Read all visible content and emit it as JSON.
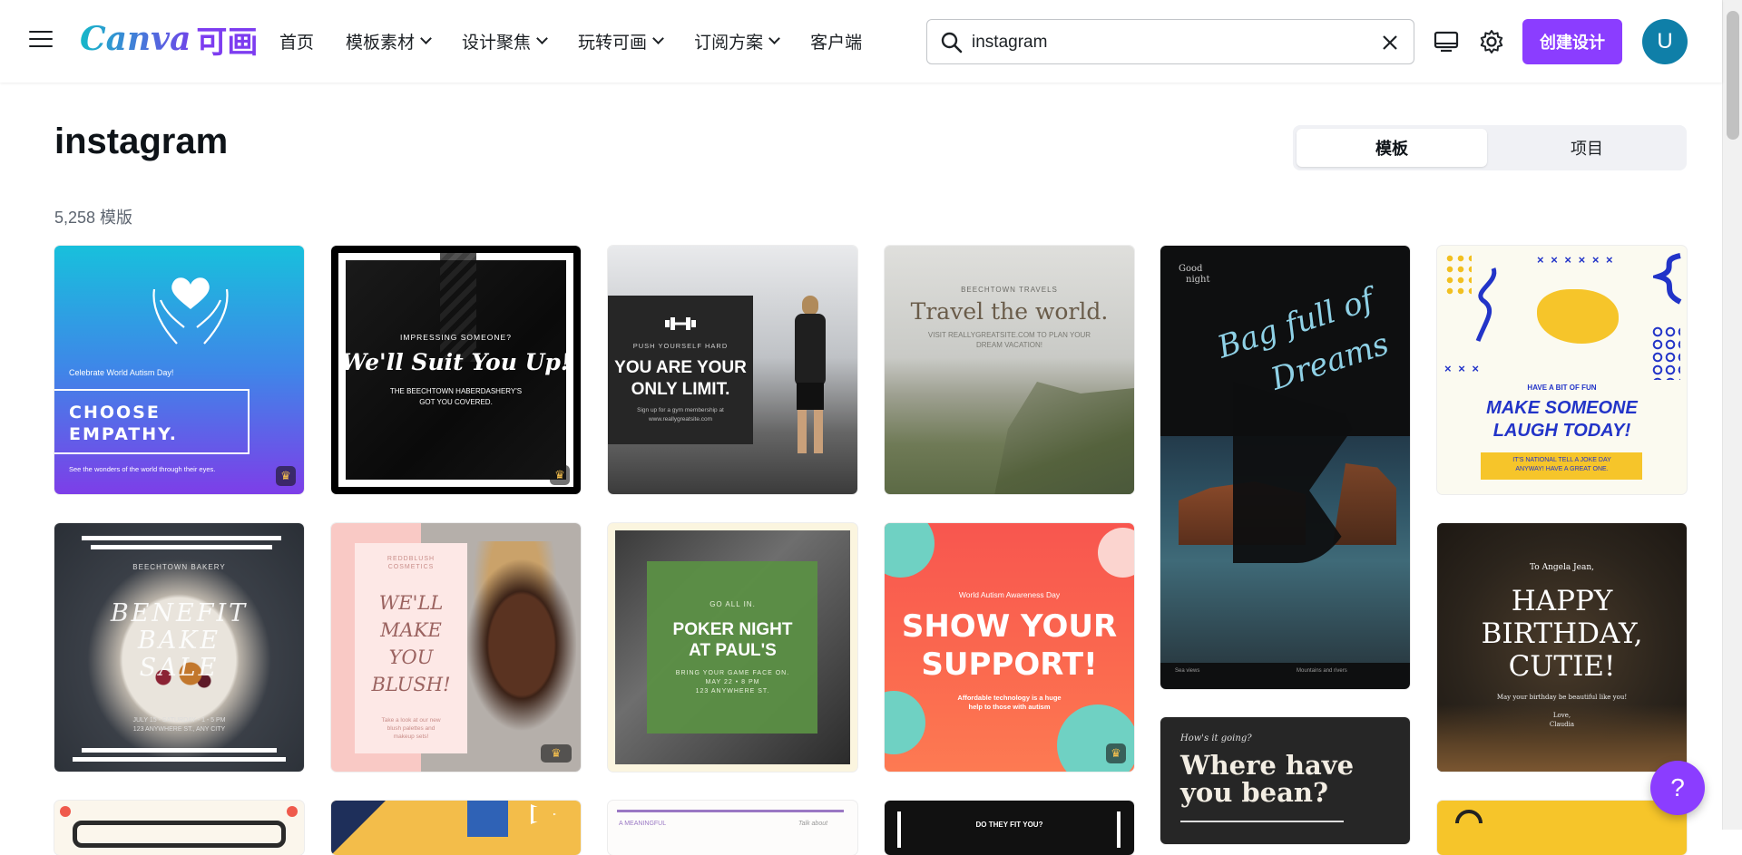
{
  "header": {
    "logo_text": "Canva",
    "logo_cn": "可画",
    "nav": [
      {
        "label": "首页",
        "dropdown": false
      },
      {
        "label": "模板素材",
        "dropdown": true
      },
      {
        "label": "设计聚焦",
        "dropdown": true
      },
      {
        "label": "玩转可画",
        "dropdown": true
      },
      {
        "label": "订阅方案",
        "dropdown": true
      },
      {
        "label": "客户端",
        "dropdown": false
      }
    ],
    "search_value": "instagram",
    "create_label": "创建设计",
    "avatar_initial": "U",
    "icons": [
      "menu-icon",
      "search-icon",
      "close-icon",
      "desktop-icon",
      "gear-icon"
    ]
  },
  "page": {
    "title": "instagram",
    "tabs": [
      {
        "label": "模板",
        "active": true
      },
      {
        "label": "项目",
        "active": false
      }
    ],
    "count_text": "5,258 模版"
  },
  "cards": {
    "c1": {
      "l1": "Celebrate World Autism Day!",
      "l2": "CHOOSE",
      "l3": "EMPATHY.",
      "l4": "See the wonders of the world through their eyes.",
      "icon": "heart-hands-icon"
    },
    "c2": {
      "l1": "IMPRESSING SOMEONE?",
      "l2": "We'll Suit You Up!",
      "l3": "THE BEECHTOWN HABERDASHERY'S",
      "l4": "GOT YOU COVERED."
    },
    "c3": {
      "l1": "PUSH YOURSELF HARD",
      "l2": "YOU ARE YOUR",
      "l3": "ONLY LIMIT.",
      "l4": "Sign up for a gym membership at",
      "l5": "www.reallygreatsite.com",
      "icon": "dumbbell-icon"
    },
    "c4": {
      "l1": "BEECHTOWN TRAVELS",
      "l2": "Travel the world.",
      "l3": "VISIT REALLYGREATSITE.COM TO PLAN YOUR",
      "l4": "DREAM VACATION!"
    },
    "c5": {
      "l1": "Good",
      "l2": "night",
      "l3": "Bag full of",
      "l4": "Dreams",
      "l5": "Sea views",
      "l6": "Mountains and rivers"
    },
    "c6": {
      "l1": "HAVE A BIT OF FUN",
      "l2": "MAKE SOMEONE",
      "l3": "LAUGH TODAY!",
      "l4": "IT'S NATIONAL TELL A JOKE DAY",
      "l5": "ANYWAY! HAVE A GREAT ONE.",
      "l6": "× × × × × ×",
      "l7": "× × ×"
    },
    "c7": {
      "l1": "BEECHTOWN BAKERY",
      "l2": "BENEFIT",
      "l3": "BAKE",
      "l4": "SALE",
      "l5": "JULY 15 - SATURDAY - 1 - 5 PM",
      "l6": "123 ANYWHERE ST., ANY CITY"
    },
    "c8": {
      "l1": "REDDBLUSH",
      "l2": "COSMETICS",
      "l3": "WE'LL",
      "l4": "MAKE",
      "l5": "YOU",
      "l6": "BLUSH!",
      "l7": "Take a look at our new",
      "l8": "blush palettes and",
      "l9": "makeup sets!"
    },
    "c9": {
      "l1": "GO ALL IN.",
      "l2": "POKER NIGHT",
      "l3": "AT PAUL'S",
      "l4": "BRING YOUR GAME FACE ON.",
      "l5": "MAY 22 • 8 PM",
      "l6": "123 ANYWHERE ST."
    },
    "c10": {
      "l1": "World Autism Awareness Day",
      "l2": "SHOW YOUR",
      "l3": "SUPPORT!",
      "l4": "Affordable technology is a huge",
      "l5": "help to those with autism"
    },
    "c11": {
      "l1": "To Angela Jean,",
      "l2": "HAPPY",
      "l3": "BIRTHDAY,",
      "l4": "CUTIE!",
      "l5": "May your birthday be beautiful like you!",
      "l6": "Love,",
      "l7": "Claudia"
    },
    "c12": {
      "l1": "How's it going?",
      "l2": "Where have",
      "l3": "you bean?"
    },
    "r3": {
      "a": "A MEANINGFUL",
      "b": "Talk about",
      "c": "DO THEY FIT YOU?"
    }
  },
  "help_label": "?"
}
